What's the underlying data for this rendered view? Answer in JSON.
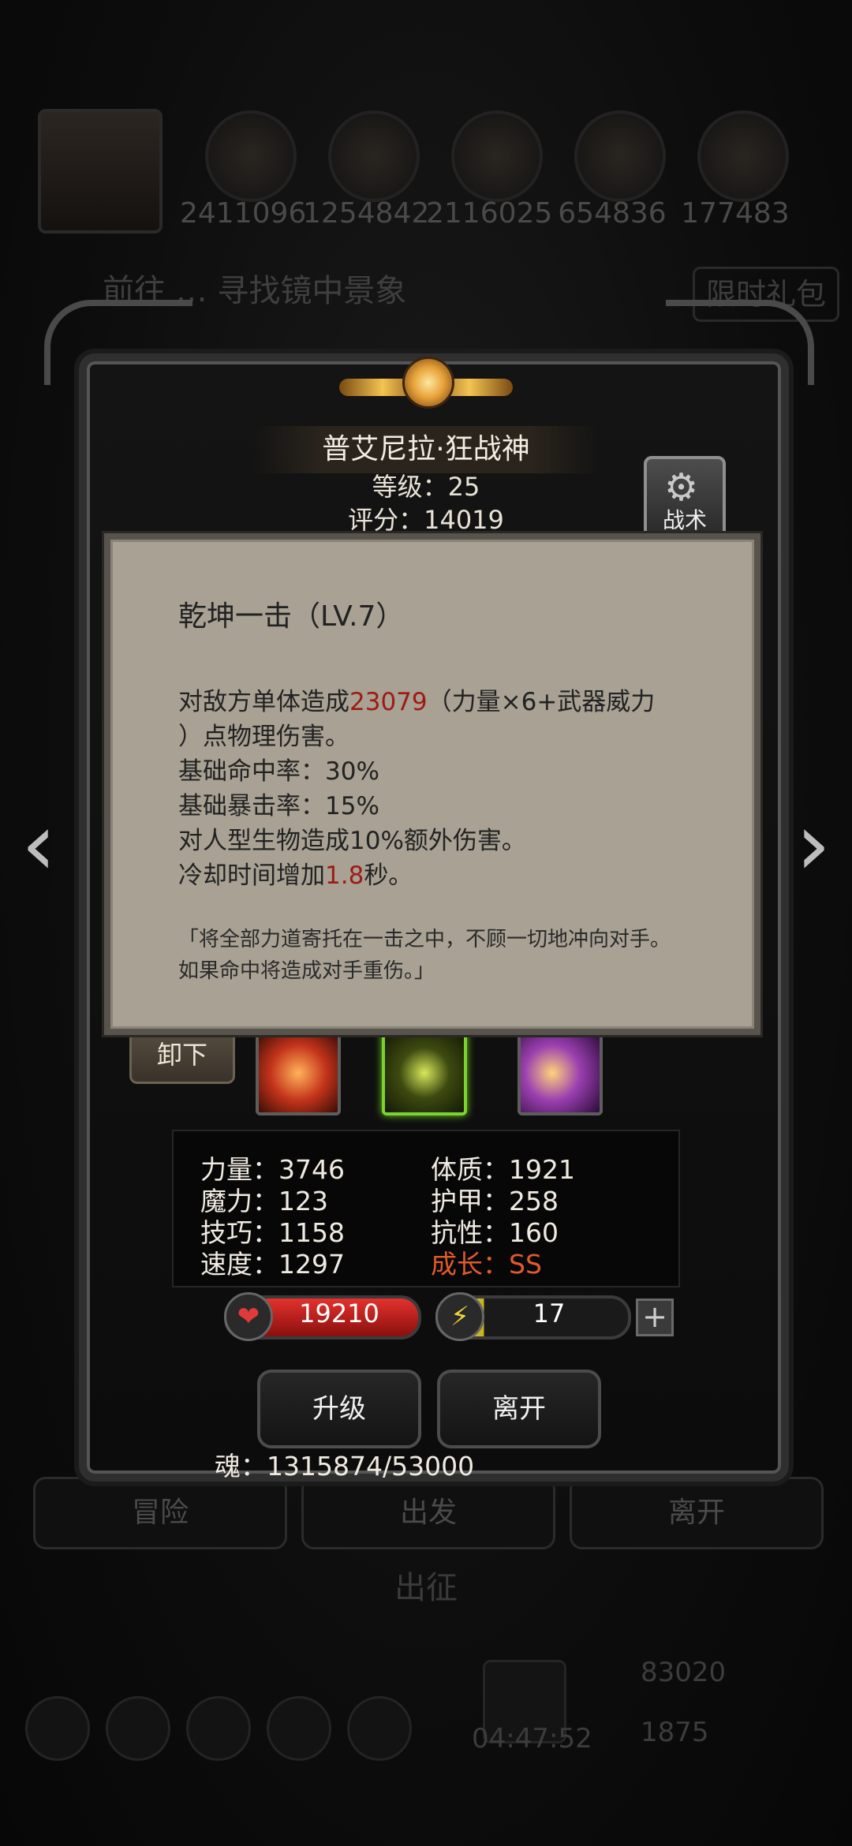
{
  "background": {
    "resources": [
      "2411096",
      "1254842",
      "2116025",
      "654836",
      "177483"
    ],
    "quest_text": "前往  …  寻找镜中景象",
    "gift_label": "限时礼包",
    "bottom_buttons": [
      "冒险",
      "出发",
      "离开"
    ],
    "depart_title": "出征",
    "timer": "04:47:52",
    "currency_1": "83020",
    "currency_2": "1875"
  },
  "hero": {
    "name": "普艾尼拉·狂战神",
    "level": "等级：25",
    "score": "评分：14019",
    "tactics_label": "战术"
  },
  "skill_tooltip": {
    "title": "乾坤一击（LV.7）",
    "line1_prefix": "对敌方单体造成",
    "damage_value": "23079",
    "line1_suffix": "（力量×6+武器威力",
    "line2": "）点物理伤害。",
    "line3": "基础命中率：30%",
    "line4": "基础暴击率：15%",
    "line5": "对人型生物造成10%额外伤害。",
    "line6_prefix": "冷却时间增加",
    "cooldown_value": "1.8",
    "line6_suffix": "秒。",
    "quote1": "「将全部力道寄托在一击之中，不顾一切地冲向对手。",
    "quote2": "如果命中将造成对手重伤。」"
  },
  "skills": {
    "unequip_label": "卸下",
    "slots": [
      "skill-slash-icon",
      "skill-qiankun-icon",
      "skill-claw-icon"
    ]
  },
  "stats": {
    "strength": "力量：3746",
    "constitution": "体质：1921",
    "magic": "魔力：123",
    "armor": "护甲：258",
    "skill": "技巧：1158",
    "resistance": "抗性：160",
    "speed": "速度：1297",
    "growth": "成长：SS"
  },
  "bars": {
    "hp": "19210",
    "energy": "17",
    "plus": "+"
  },
  "actions": {
    "upgrade": "升级",
    "leave": "离开"
  },
  "soul": "魂：1315874/53000",
  "nav": {
    "prev": "‹",
    "next": "›"
  },
  "colors": {
    "accent_red": "#9e1b14",
    "growth_orange": "#e05a2c",
    "hp_red": "#e3322e",
    "energy_yellow": "#e8d23a",
    "selected_green": "#7cd230"
  }
}
